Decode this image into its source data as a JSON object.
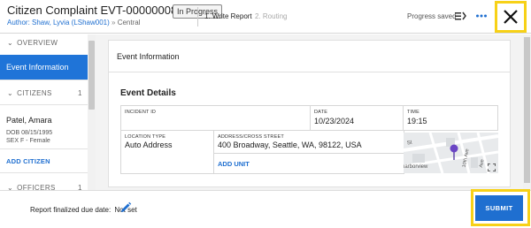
{
  "header": {
    "title": "Citizen Complaint EVT-00000008-1",
    "status_badge": "In Progress",
    "author": "Author: Shaw, Lyvia (LShaw001)",
    "separator": "»",
    "location": "Central",
    "steps": [
      "1. Write Report",
      "2. Routing"
    ],
    "progress_text": "Progress saved",
    "icons": {
      "progress": "progress-list-icon",
      "more": "more-horizontal-icon",
      "close": "close-icon"
    }
  },
  "sidebar": {
    "sections": [
      {
        "label": "OVERVIEW",
        "count": ""
      },
      {
        "label": "CITIZENS",
        "count": "1"
      },
      {
        "label": "OFFICERS",
        "count": "1"
      }
    ],
    "active_item": "Event Information",
    "citizen": {
      "name": "Patel, Amara",
      "dob": "DOB  08/15/1995",
      "sex": "SEX   F - Female"
    },
    "add_citizen": "ADD CITIZEN"
  },
  "main": {
    "section_title": "Event Information",
    "subsection_title": "Event Details",
    "fields": {
      "incident_id": {
        "label": "INCIDENT ID",
        "value": ""
      },
      "date": {
        "label": "DATE",
        "value": "10/23/2024"
      },
      "time": {
        "label": "TIME",
        "value": "19:15"
      },
      "location_type": {
        "label": "LOCATION TYPE",
        "value": "Auto Address"
      },
      "address": {
        "label": "ADDRESS/CROSS STREET",
        "value": "400 Broadway, Seattle, WA, 98122, USA"
      }
    },
    "add_unit": "ADD UNIT",
    "map_labels": [
      "St",
      "harborview",
      "10th Ave",
      "Ave"
    ]
  },
  "footer": {
    "due_label": "Report finalized due date:",
    "due_value": "Not set",
    "submit_label": "SUBMIT"
  },
  "colors": {
    "accent": "#1f6fd0",
    "highlight": "#f7d117",
    "active_bg": "#1f74d8"
  }
}
